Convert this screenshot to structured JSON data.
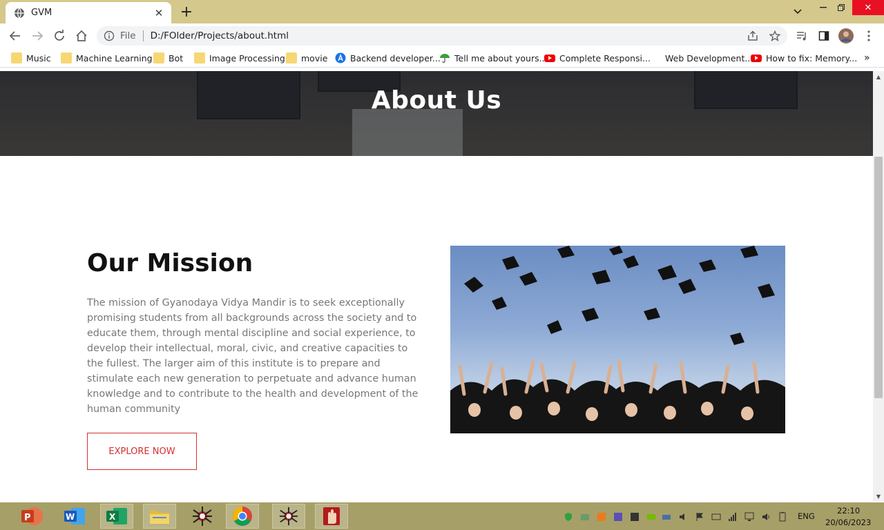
{
  "browser": {
    "tab": {
      "title": "GVM",
      "favicon": "globe-icon"
    },
    "new_tab_label": "+",
    "address": {
      "scheme_label": "File",
      "url": "D:/FOlder/Projects/about.html"
    },
    "bookmarks": [
      {
        "label": "Music",
        "icon": "folder-icon"
      },
      {
        "label": "Machine Learning",
        "icon": "folder-icon"
      },
      {
        "label": "Bot",
        "icon": "folder-icon"
      },
      {
        "label": "Image Processing",
        "icon": "folder-icon"
      },
      {
        "label": "movie",
        "icon": "folder-icon"
      },
      {
        "label": "Backend developer...",
        "icon": "a-logo-icon"
      },
      {
        "label": "Tell me about yours...",
        "icon": "umbrella-icon"
      },
      {
        "label": "Complete Responsi...",
        "icon": "youtube-icon"
      },
      {
        "label": "Web Development...",
        "icon": "none"
      },
      {
        "label": "How to fix: Memory...",
        "icon": "youtube-icon"
      }
    ],
    "more_bookmarks": "»"
  },
  "page": {
    "hero_title": "About Us",
    "mission": {
      "title": "Our Mission",
      "text": "The mission of Gyanodaya Vidya Mandir is to seek exceptionally promising students from all backgrounds across the society and to educate them, through mental discipline and social experience, to develop their intellectual, moral, civic, and creative capacities to the fullest. The larger aim of this institute is to prepare and stimulate each new generation to perpetuate and advance human knowledge and to contribute to the health and development of the human community",
      "button_label": "EXPLORE NOW"
    },
    "accent_color": "#d43030"
  },
  "taskbar": {
    "apps": [
      "powerpoint-icon",
      "word-icon",
      "excel-icon",
      "file-explorer-icon",
      "app-spider-icon",
      "chrome-icon",
      "app-spider-icon",
      "app-hand-icon"
    ],
    "language": "ENG",
    "time": "22:10",
    "date": "20/06/2023"
  }
}
